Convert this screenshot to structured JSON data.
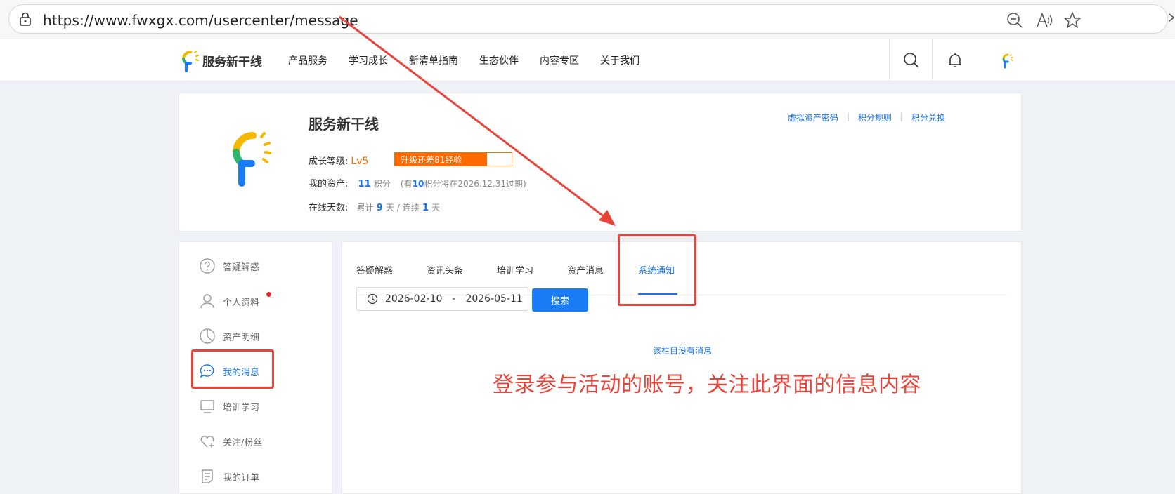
{
  "browser": {
    "url": "https://www.fwxgx.com/usercenter/message",
    "icons": [
      "lock-icon",
      "zoom-out-icon",
      "read-aloud-icon",
      "favorite-star-icon"
    ]
  },
  "header": {
    "brand": "服务新干线",
    "nav": [
      "产品服务",
      "学习成长",
      "新清单指南",
      "生态伙伴",
      "内容专区",
      "关于我们"
    ]
  },
  "profile": {
    "name": "服务新干线",
    "growth_label": "成长等级:",
    "level": "Lv5",
    "upgrade_text": "升级还差81经验",
    "progress_fraction": 0.79,
    "assets_label": "我的资产:",
    "points_value": "11",
    "points_unit": "积分",
    "expire_prefix": "(有",
    "expire_points": "10",
    "expire_suffix": "积分将在2026.12.31过期)",
    "online_label": "在线天数:",
    "cumulative_prefix": "累计",
    "cumulative_days": "9",
    "cumulative_unit": "天 /",
    "consecutive_prefix": "连续",
    "consecutive_days": "1",
    "consecutive_unit": "天",
    "links": [
      "虚拟资产密码",
      "积分规则",
      "积分兑换"
    ]
  },
  "sidebar": {
    "items": [
      {
        "label": "答疑解惑",
        "icon": "question-icon"
      },
      {
        "label": "个人资料",
        "icon": "user-icon"
      },
      {
        "label": "资产明细",
        "icon": "pie-chart-icon"
      },
      {
        "label": "我的消息",
        "icon": "chat-bubble-icon"
      },
      {
        "label": "培训学习",
        "icon": "monitor-icon"
      },
      {
        "label": "关注/粉丝",
        "icon": "heart-plus-icon"
      },
      {
        "label": "我的订单",
        "icon": "document-icon"
      }
    ]
  },
  "main": {
    "tabs": [
      "答疑解惑",
      "资讯头条",
      "培训学习",
      "资产消息",
      "系统通知"
    ],
    "active_tab": "系统通知",
    "date_start": "2026-02-10",
    "date_sep": "-",
    "date_end": "2026-05-11",
    "search_label": "搜索",
    "empty_text": "该栏目没有消息"
  },
  "annotation": {
    "note": "登录参与活动的账号，关注此界面的信息内容",
    "color": "#e8443a"
  },
  "colors": {
    "accent": "#1a73e8",
    "orange": "#ff6a00"
  }
}
